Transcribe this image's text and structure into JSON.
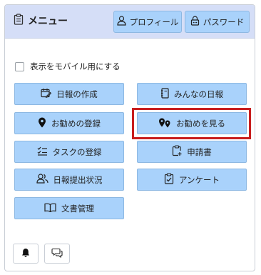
{
  "header": {
    "title": "メニュー",
    "profile_label": "プロフィール",
    "password_label": "パスワード"
  },
  "mobile_toggle": {
    "label": "表示をモバイル用にする",
    "checked": false
  },
  "menu": {
    "items": [
      {
        "label": "日報の作成",
        "icon": "calendar-edit-icon"
      },
      {
        "label": "みんなの日報",
        "icon": "notebook-icon"
      },
      {
        "label": "お勧めの登録",
        "icon": "map-pin-icon"
      },
      {
        "label": "お勧めを見る",
        "icon": "map-pins-icon"
      },
      {
        "label": "タスクの登録",
        "icon": "checklist-icon"
      },
      {
        "label": "申請書",
        "icon": "clipboard-plus-icon"
      },
      {
        "label": "日報提出状況",
        "icon": "users-icon"
      },
      {
        "label": "アンケート",
        "icon": "clipboard-check-icon"
      },
      {
        "label": "文書管理",
        "icon": "open-book-icon"
      }
    ],
    "highlighted": "お勧めを見る"
  },
  "footer": {
    "icons": [
      "bell-icon",
      "chat-icon"
    ]
  },
  "colors": {
    "header_bg": "#d5def7",
    "button_bg": "#a9d2fb",
    "highlight": "#c81e1e"
  }
}
